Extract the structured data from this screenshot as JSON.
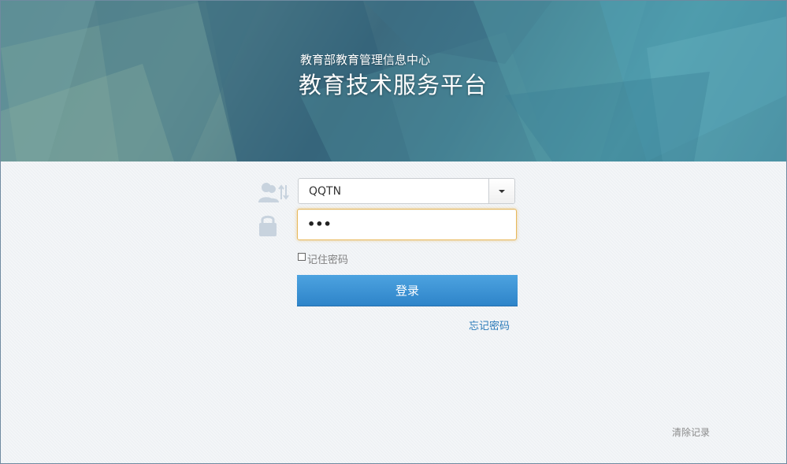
{
  "header": {
    "organization": "教育部教育管理信息中心",
    "platform_title": "教育技术服务平台"
  },
  "login": {
    "username": "QQTN",
    "password_masked": "•••",
    "remember_label": "记住密码",
    "remember_checked": false,
    "login_button": "登录",
    "forgot_link": "忘记密码"
  },
  "footer": {
    "clear_records": "清除记录"
  },
  "colors": {
    "accent": "#3a8fd4",
    "focus_border": "#e8b85a",
    "link": "#2a7ab8"
  },
  "icons": {
    "user": "user-switch-icon",
    "password": "lock-icon",
    "dropdown": "chevron-down-icon"
  }
}
